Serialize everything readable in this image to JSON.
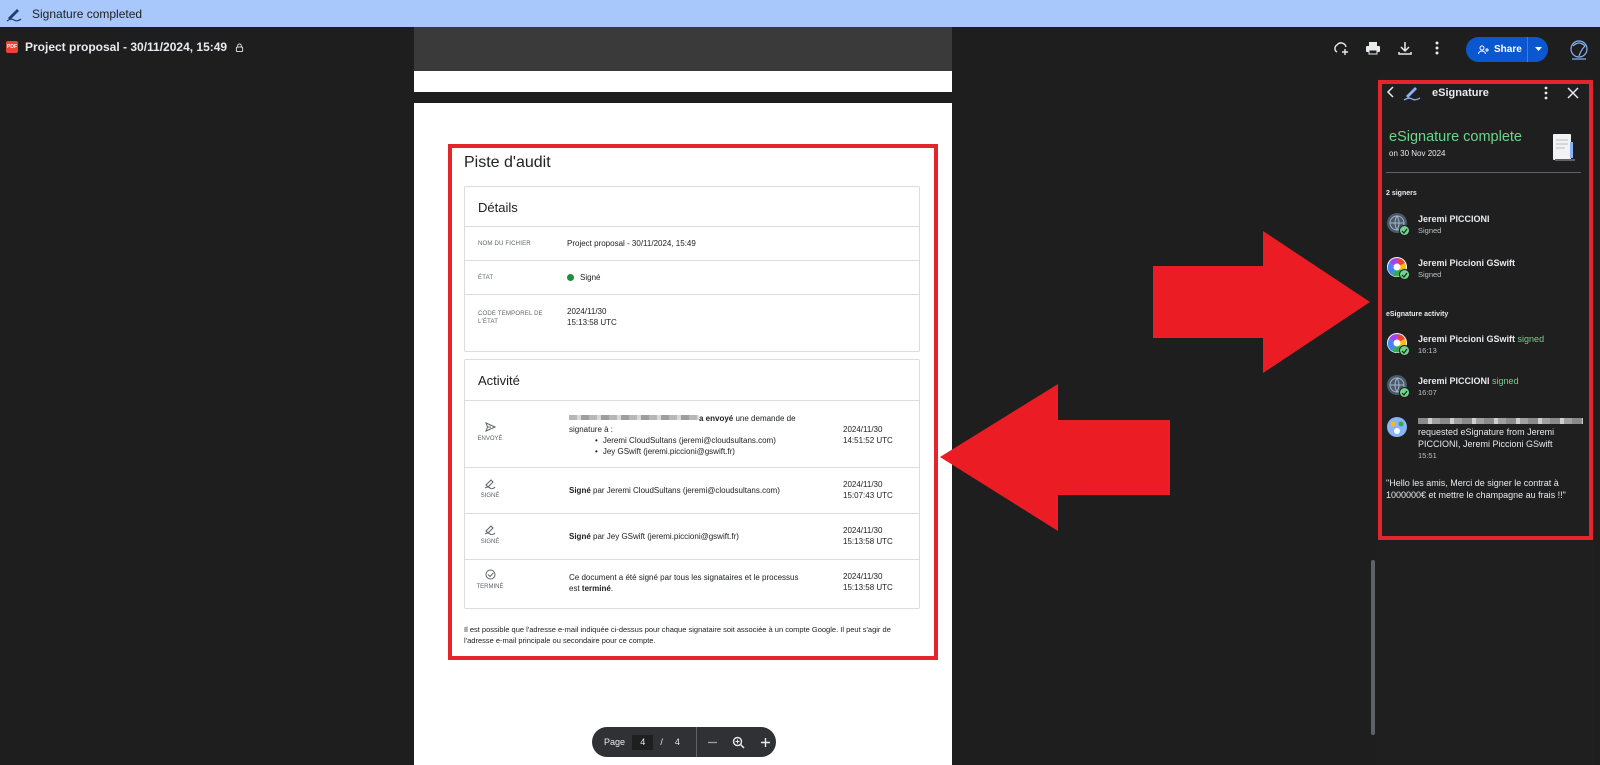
{
  "window": {
    "title": "Signature completed"
  },
  "file": {
    "badge": "PDF",
    "title": "Project proposal - 30/11/2024, 15:49"
  },
  "toolbar": {
    "share_label": "Share"
  },
  "audit": {
    "title": "Piste d'audit",
    "details": {
      "heading": "Détails",
      "rows": [
        {
          "key": "NOM DU FICHIER",
          "value": "Project proposal - 30/11/2024, 15:49"
        },
        {
          "key": "ÉTAT",
          "value": "Signé"
        },
        {
          "key": "CODE TEMPOREL DE L'ÉTAT",
          "value_line1": "2024/11/30",
          "value_line2": "15:13:58 UTC"
        }
      ]
    },
    "activity": {
      "heading": "Activité",
      "items": [
        {
          "label": "ENVOYÉ",
          "text_bold": "a envoyé",
          "text_rest": " une demande de signature à :",
          "recipients": [
            "Jeremi CloudSultans (jeremi@cloudsultans.com)",
            "Jey GSwift (jeremi.piccioni@gswift.fr)"
          ],
          "date": "2024/11/30",
          "time": "14:51:52 UTC"
        },
        {
          "label": "SIGNÉ",
          "text_bold": "Signé",
          "text_rest": " par Jeremi CloudSultans (jeremi@cloudsultans.com)",
          "date": "2024/11/30",
          "time": "15:07:43 UTC"
        },
        {
          "label": "SIGNÉ",
          "text_bold": "Signé",
          "text_rest": " par Jey GSwift (jeremi.piccioni@gswift.fr)",
          "date": "2024/11/30",
          "time": "15:13:58 UTC"
        },
        {
          "label": "TERMINÉ",
          "text_rest": "Ce document a été signé par tous les signataires et le processus est ",
          "text_bold": "terminé",
          "text_end": ".",
          "date": "2024/11/30",
          "time": "15:13:58 UTC"
        }
      ]
    },
    "footnote": "Il est possible que l'adresse e-mail indiquée ci-dessus pour chaque signataire soit associée à un compte Google. Il peut s'agir de l'adresse e-mail principale ou secondaire pour ce compte."
  },
  "pager": {
    "page_label": "Page",
    "current": "4",
    "separator": "/",
    "total": "4"
  },
  "panel": {
    "title": "eSignature",
    "complete_title": "eSignature complete",
    "complete_date": "on 30 Nov 2024",
    "signers_label": "2 signers",
    "signers": [
      {
        "name": "Jeremi PICCIONI",
        "status": "Signed"
      },
      {
        "name": "Jeremi Piccioni GSwift",
        "status": "Signed"
      }
    ],
    "activity_label": "eSignature activity",
    "activity": [
      {
        "name": "Jeremi Piccioni GSwift",
        "action": "signed",
        "time": "16:13"
      },
      {
        "name": "Jeremi PICCIONI",
        "action": "signed",
        "time": "16:07"
      }
    ],
    "request": {
      "text": "requested eSignature from Jeremi PICCIONI, Jeremi Piccioni GSwift",
      "time": "15:51"
    },
    "message": "\"Hello les amis, Merci de signer le contrat à 1000000€ et mettre le champagne au frais !!\""
  },
  "colors": {
    "highlight": "#e3262b",
    "accent_green": "#6dd58c",
    "share_blue": "#0b57d0"
  }
}
